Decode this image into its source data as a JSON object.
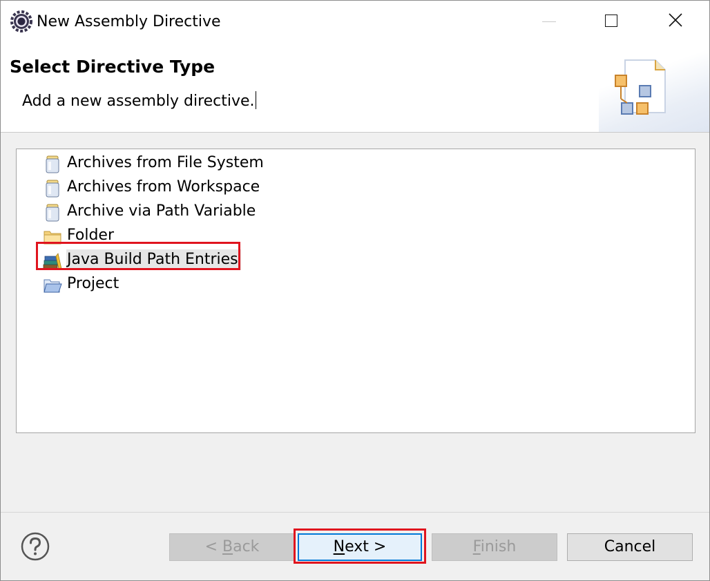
{
  "window": {
    "title": "New Assembly Directive",
    "icons": {
      "app": "eclipse-gear-icon",
      "minimize": "minimize-icon",
      "maximize": "maximize-icon",
      "close": "close-icon"
    }
  },
  "banner": {
    "heading": "Select Directive Type",
    "description": "Add a new assembly directive.",
    "icon": "wizard-document-icon"
  },
  "directive_types": [
    {
      "label": "Archives from File System",
      "icon": "jar-archive-icon",
      "selected": false
    },
    {
      "label": "Archives from Workspace",
      "icon": "jar-archive-icon",
      "selected": false
    },
    {
      "label": "Archive via Path Variable",
      "icon": "jar-archive-icon",
      "selected": false
    },
    {
      "label": "Folder",
      "icon": "folder-icon",
      "selected": false
    },
    {
      "label": "Java Build Path Entries",
      "icon": "library-books-icon",
      "selected": true
    },
    {
      "label": "Project",
      "icon": "open-folder-icon",
      "selected": false
    }
  ],
  "buttons": {
    "help_icon": "help-icon",
    "back": {
      "mnemonic": "B",
      "text_before": "< ",
      "text_after": "ack",
      "enabled": false
    },
    "next": {
      "mnemonic": "N",
      "text_before": "",
      "text_after": "ext >",
      "enabled": true
    },
    "finish": {
      "mnemonic": "F",
      "text_before": "",
      "text_after": "inish",
      "enabled": false
    },
    "cancel": {
      "label": "Cancel",
      "enabled": true
    }
  },
  "colors": {
    "highlight_outline": "#e0141e",
    "default_button_border": "#0078d7",
    "selection_background": "#e6e6e6"
  }
}
